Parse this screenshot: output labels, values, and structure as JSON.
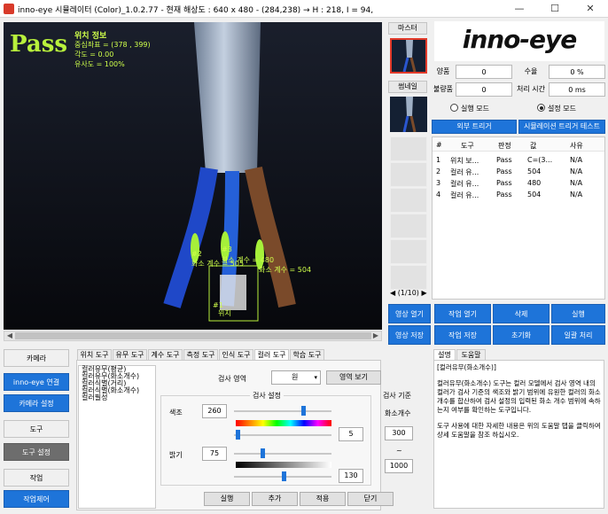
{
  "window": {
    "title": "inno-eye 시뮬레이터 (Color)_1.0.2.77 - 현재 해상도 : 640 x 480 - (284,238) → H : 218, I = 94,",
    "minimize": "—",
    "maximize": "☐",
    "close": "✕"
  },
  "camera": {
    "result": "Pass",
    "info_title": "위치 정보",
    "center_coord": "중심좌표 = (378 , 399)",
    "angle": "각도 = 0.00",
    "similarity": "유사도 = 100%",
    "markers": [
      {
        "id": "#2",
        "label": "화소 계수 = 505"
      },
      {
        "id": "#3",
        "label": "화소 계수 = 480"
      },
      {
        "id": "",
        "label": "화소 계수 = 504"
      },
      {
        "id": "#1",
        "label": "위치"
      }
    ],
    "scroll_left": "◀",
    "scroll_right": "▶",
    "accent_color": "#b8f03c"
  },
  "thumbs": {
    "master_label": "마스터",
    "thumbnail_label": "썸네일",
    "pager": "◀ (1/10) ▶"
  },
  "logo": "inno-eye",
  "stats": {
    "good_label": "양품",
    "good_value": "0",
    "yield_label": "수율",
    "yield_value": "0 %",
    "bad_label": "불량품",
    "bad_value": "0",
    "time_label": "처리 시간",
    "time_value": "0 ms"
  },
  "mode": {
    "run_mode": "실행 모드",
    "setup_mode": "설정 모드",
    "selected": "setup"
  },
  "triggers": {
    "external": "외부 트리거",
    "simulation": "시뮬레이션 트리거 테스트"
  },
  "results_table": {
    "headers": [
      "#",
      "도구",
      "판정",
      "값",
      "사유"
    ],
    "rows": [
      [
        "1",
        "위치 보...",
        "Pass",
        "C=(3...",
        "N/A"
      ],
      [
        "2",
        "컬러 유...",
        "Pass",
        "504",
        "N/A"
      ],
      [
        "3",
        "컬러 유...",
        "Pass",
        "480",
        "N/A"
      ],
      [
        "4",
        "컬러 유...",
        "Pass",
        "504",
        "N/A"
      ]
    ]
  },
  "actions": {
    "open_image": "영상 열기",
    "open_job": "작업 열기",
    "delete": "삭제",
    "run": "실행",
    "save_image": "영상 저장",
    "save_job": "작업 저장",
    "reset": "초기화",
    "batch": "일괄 처리"
  },
  "nav": {
    "camera": "카메라",
    "connect": "inno-eye 연결",
    "camera_settings": "카메라 설정",
    "tools": "도구",
    "tool_settings": "도구 설정",
    "job": "작업",
    "job_control": "작업제어"
  },
  "tool_tabs": [
    "위치 도구",
    "유무 도구",
    "계수 도구",
    "측정 도구",
    "인식 도구",
    "컬러 도구",
    "학습 도구"
  ],
  "tool_list": [
    "컬러유무(평균)",
    "컬러유무(화소개수)",
    "컬러식별(거리)",
    "컬러식별(화소개수)",
    "컬러필성"
  ],
  "inspection": {
    "area_label": "검사 영역",
    "area_value": "원",
    "show_area": "영역 보기",
    "settings_title": "검사 설정",
    "hue_label": "색조",
    "hue_value": "260",
    "hue_range": "5",
    "hue_knob": 0.72,
    "hue_range_knob": 0.02,
    "brightness_label": "밝기",
    "brightness_value": "75",
    "brightness_range": "130",
    "brightness_knob": 0.29,
    "brightness_range_knob": 0.51,
    "criteria_title": "검사 기준",
    "criteria_label": "화소개수",
    "criteria_min": "300",
    "criteria_sep": "~",
    "criteria_max": "1000"
  },
  "bottom_buttons": {
    "run": "실행",
    "add": "추가",
    "apply": "적용",
    "close": "닫기"
  },
  "help": {
    "tab_description": "설명",
    "tab_help": "도움말",
    "title": "[컬러유무(화소개수)]",
    "body1": "컬러유무(화소개수) 도구는 컬러 모델에서 검사 영역 내의 컬러가 검사 기준의 색조와 밝기 범위에 유원한 컬러의 화소 개수를 합산하여 검사 설정의 입력된 화소 개수 범위에 속하는지 여부를 확인하는 도구입니다.",
    "body2": "도구 사용에 대한 자세한 내용은 위의 도움말 탭을 클릭하여 상세 도움말을 참조 하십시오."
  }
}
